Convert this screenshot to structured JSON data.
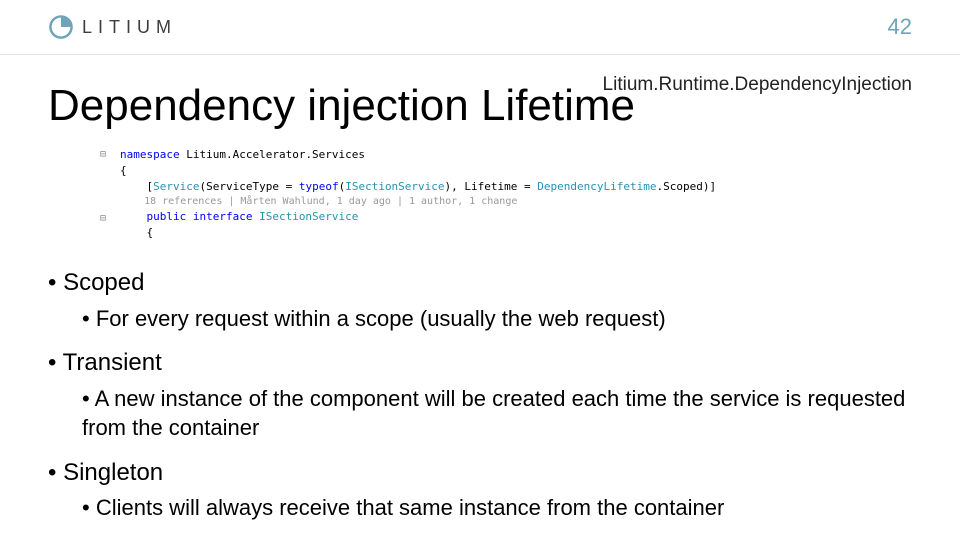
{
  "header": {
    "logo_text": "LITIUM",
    "page_number": "42"
  },
  "namespace_label": "Litium.Runtime.DependencyInjection",
  "title": "Dependency injection Lifetime",
  "code": {
    "line1_pre": "namespace",
    "line1_ns": " Litium.Accelerator.Services",
    "brace_open": "{",
    "attr_open": "    [",
    "attr_service": "Service",
    "attr_p1": "(ServiceType = ",
    "attr_typeof": "typeof",
    "attr_p2": "(",
    "attr_iface": "ISectionService",
    "attr_p3": "), Lifetime = ",
    "attr_enum": "DependencyLifetime",
    "attr_p4": ".Scoped)]",
    "meta": "    18 references | Mårten Wahlund, 1 day ago | 1 author, 1 change",
    "decl_pre": "    public interface ",
    "decl_name": "ISectionService",
    "brace_open2": "    {"
  },
  "bullets": [
    {
      "label": "Scoped",
      "sub": "For every request within a scope (usually the web request)"
    },
    {
      "label": "Transient",
      "sub": "A new instance of the component will be created each time the service is requested from the container"
    },
    {
      "label": "Singleton",
      "sub": "Clients will always receive that same instance from the container"
    }
  ]
}
